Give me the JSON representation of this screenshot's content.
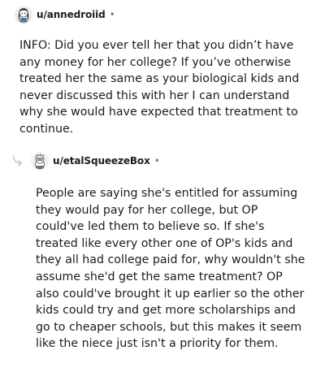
{
  "comments": [
    {
      "username": "u/annedroiid",
      "separator": "•",
      "avatar_icon": "snoo-avatar-icon",
      "body": "INFO: Did you ever tell her that you didn’t have any money for her college? If you’ve otherwise treated her the same as your biological kids and never discussed this with her I can understand why she would have expected that treatment to continue."
    },
    {
      "username": "u/etalSqueezeBox",
      "separator": "•",
      "avatar_icon": "snoo-avatar-icon",
      "reply_icon": "reply-arrow-icon",
      "body": "People are saying she's entitled for assuming they would pay for her college, but OP could've led them to believe so. If she's treated like every other one of OP's kids and they all had college paid for, why wouldn't she assume she'd get the same treatment? OP also could've brought it up earlier so the other kids could try and get more scholarships and go to cheaper schools, but this makes it seem like the niece just isn't a priority for them."
    }
  ],
  "colors": {
    "text": "#1c1c1c",
    "muted": "#7c7c7c",
    "background": "#ffffff"
  }
}
